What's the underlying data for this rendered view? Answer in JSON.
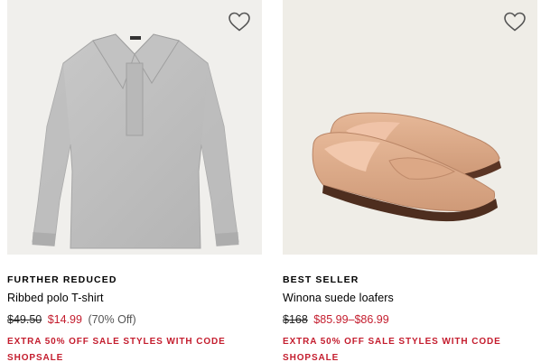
{
  "products": [
    {
      "badge": "FURTHER REDUCED",
      "name": "Ribbed polo T-shirt",
      "original_price": "$49.50",
      "sale_price": "$14.99",
      "discount": "(70% Off)",
      "promo": "EXTRA 50% OFF SALE STYLES WITH CODE SHOPSALE",
      "wishlist_icon": "heart-outline-icon"
    },
    {
      "badge": "BEST SELLER",
      "name": "Winona suede loafers",
      "original_price": "$168",
      "sale_price": "$85.99–$86.99",
      "discount": "",
      "promo": "EXTRA 50% OFF SALE STYLES WITH CODE SHOPSALE",
      "wishlist_icon": "heart-outline-icon"
    }
  ],
  "colors": {
    "sale_red": "#c41d2e",
    "image_bg": "#f0efec"
  }
}
